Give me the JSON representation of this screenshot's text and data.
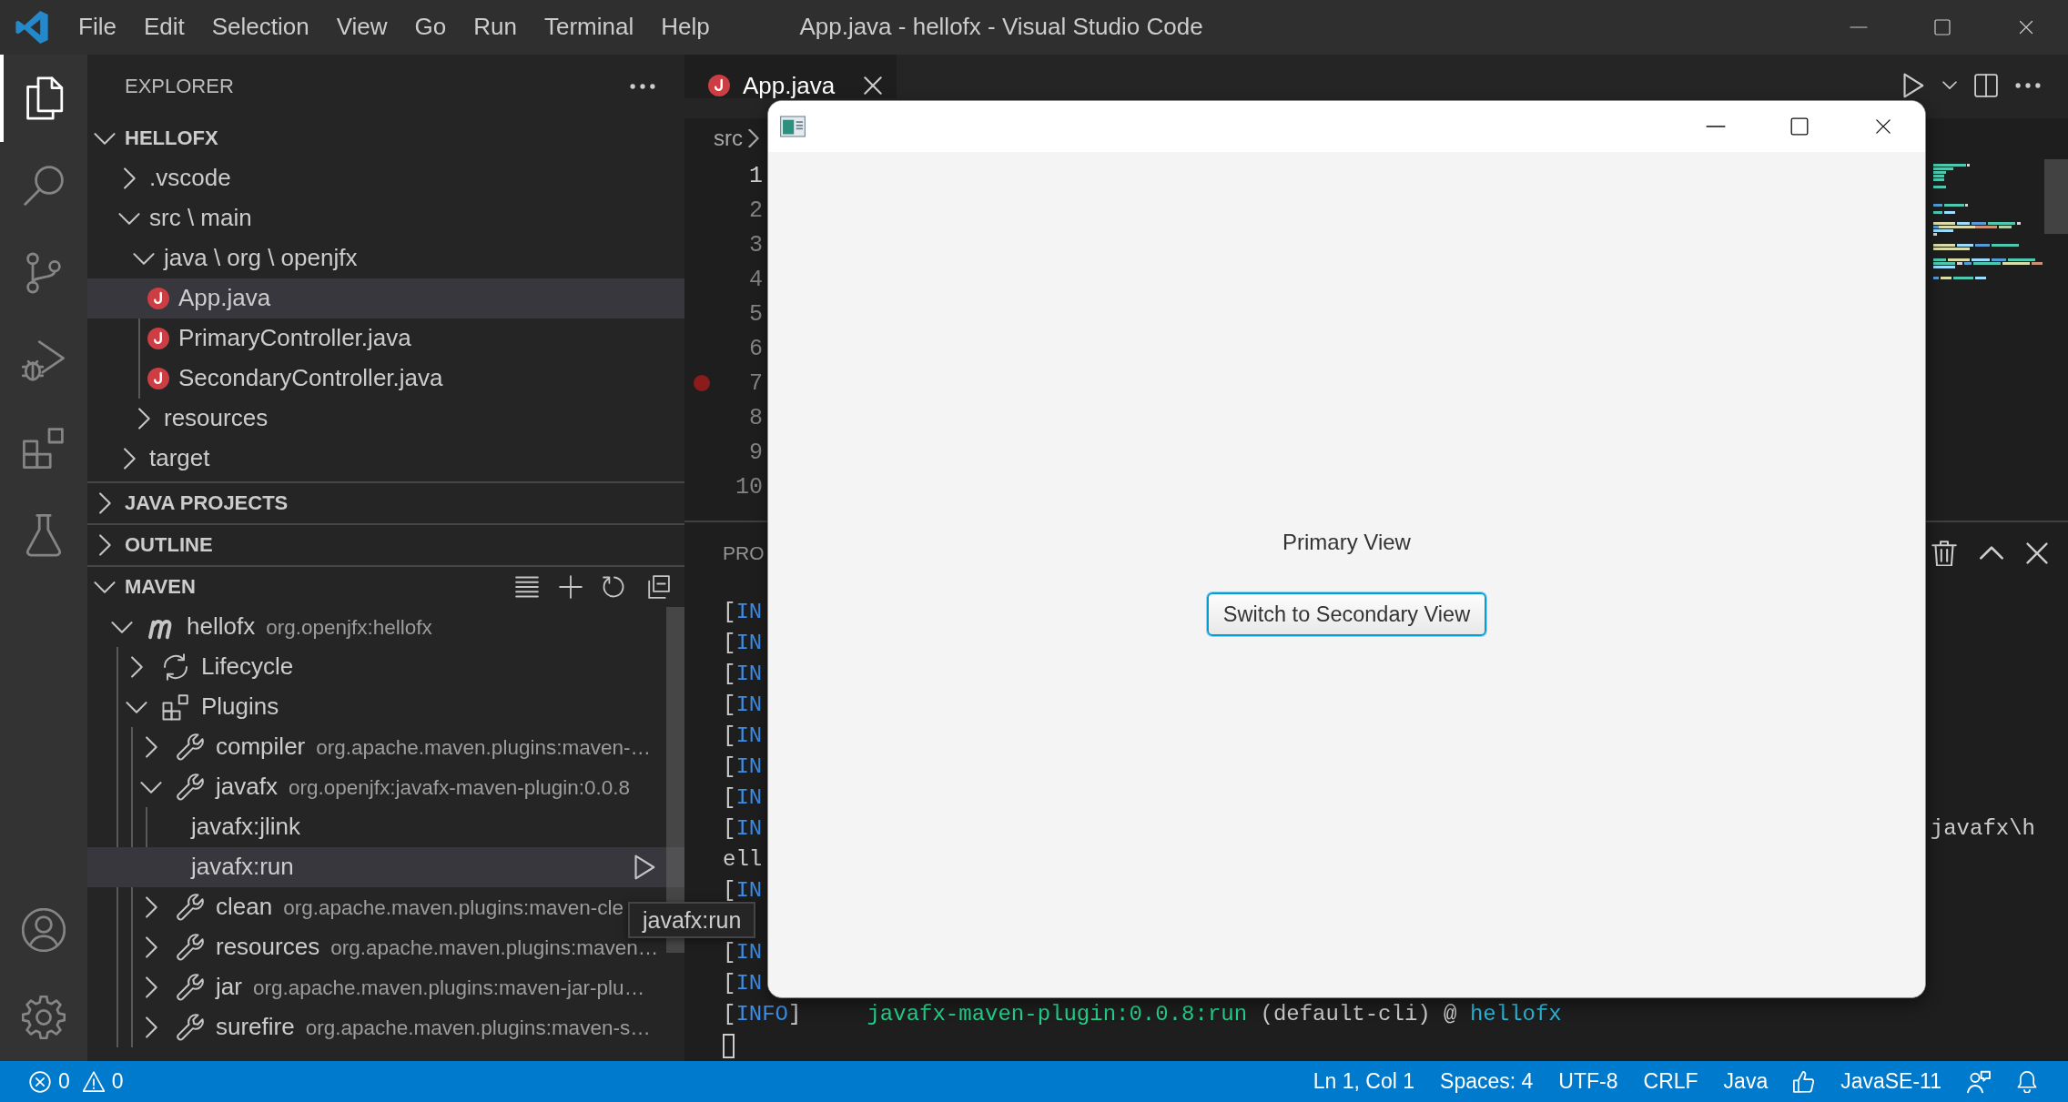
{
  "window": {
    "title": "App.java - hellofx - Visual Studio Code"
  },
  "menu": [
    "File",
    "Edit",
    "Selection",
    "View",
    "Go",
    "Run",
    "Terminal",
    "Help"
  ],
  "activity_bar": {
    "items": [
      {
        "kind": "explorer",
        "selected": true
      },
      {
        "kind": "search",
        "selected": false
      },
      {
        "kind": "source_control",
        "selected": false
      },
      {
        "kind": "run_debug",
        "selected": false
      },
      {
        "kind": "extensions",
        "selected": false
      },
      {
        "kind": "testing",
        "selected": false
      }
    ],
    "bottom": [
      {
        "kind": "accounts"
      },
      {
        "kind": "manage"
      }
    ]
  },
  "sidebar": {
    "title": "EXPLORER",
    "sections": [
      {
        "kind": "explorer",
        "title": "HELLOFX",
        "expanded": true,
        "hovered": false,
        "tree": [
          {
            "kind": "folder",
            "label": ".vscode",
            "expanded": false,
            "selected": false
          },
          {
            "kind": "folder",
            "label": "src \\ main",
            "expanded": true,
            "selected": false,
            "children": [
              {
                "kind": "folder",
                "label": "java \\ org \\ openjfx",
                "expanded": true,
                "selected": false,
                "children": [
                  {
                    "kind": "java_file",
                    "label": "App.java",
                    "selected": true
                  },
                  {
                    "kind": "java_file",
                    "label": "PrimaryController.java",
                    "selected": false
                  },
                  {
                    "kind": "java_file",
                    "label": "SecondaryController.java",
                    "selected": false
                  }
                ]
              },
              {
                "kind": "folder",
                "label": "resources",
                "expanded": false,
                "selected": false
              }
            ]
          },
          {
            "kind": "folder",
            "label": "target",
            "expanded": false,
            "selected": false
          }
        ]
      },
      {
        "kind": "view",
        "title": "JAVA PROJECTS",
        "expanded": false
      },
      {
        "kind": "view",
        "title": "OUTLINE",
        "expanded": false
      },
      {
        "kind": "maven",
        "title": "MAVEN",
        "expanded": true,
        "hovered": true,
        "tree": [
          {
            "kind": "project",
            "label": "hellofx",
            "description": "org.openjfx:hellofx",
            "expanded": true,
            "selected": false,
            "children": [
              {
                "kind": "lifecycle",
                "label": "Lifecycle",
                "expanded": false,
                "selected": false
              },
              {
                "kind": "plugins",
                "label": "Plugins",
                "expanded": true,
                "selected": false,
                "children": [
                  {
                    "kind": "plugin",
                    "label": "compiler",
                    "description": "org.apache.maven.plugins:maven-…",
                    "expanded": false,
                    "selected": false
                  },
                  {
                    "kind": "plugin",
                    "label": "javafx",
                    "description": "org.openjfx:javafx-maven-plugin:0.0.8",
                    "expanded": true,
                    "selected": false,
                    "children": [
                      {
                        "kind": "goal",
                        "label": "javafx:jlink",
                        "selected": false
                      },
                      {
                        "kind": "goal",
                        "label": "javafx:run",
                        "selected": true
                      }
                    ]
                  },
                  {
                    "kind": "plugin",
                    "label": "clean",
                    "description": "org.apache.maven.plugins:maven-cle",
                    "expanded": false,
                    "selected": false
                  },
                  {
                    "kind": "plugin",
                    "label": "resources",
                    "description": "org.apache.maven.plugins:maven…",
                    "expanded": false,
                    "selected": false
                  },
                  {
                    "kind": "plugin",
                    "label": "jar",
                    "description": "org.apache.maven.plugins:maven-jar-plu…",
                    "expanded": false,
                    "selected": false
                  },
                  {
                    "kind": "plugin",
                    "label": "surefire",
                    "description": "org.apache.maven.plugins:maven-s…",
                    "expanded": false,
                    "selected": false
                  }
                ]
              }
            ]
          }
        ]
      }
    ]
  },
  "editor": {
    "tabs": [
      {
        "kind": "java_file",
        "label": "App.java",
        "selected": true
      }
    ],
    "breadcrumb": [
      "src"
    ],
    "lines": [
      {
        "number": "1",
        "current": true,
        "breakpoint": false
      },
      {
        "number": "2",
        "current": false,
        "breakpoint": false
      },
      {
        "number": "3",
        "current": false,
        "breakpoint": false
      },
      {
        "number": "4",
        "current": false,
        "breakpoint": false
      },
      {
        "number": "5",
        "current": false,
        "breakpoint": false
      },
      {
        "number": "6",
        "current": false,
        "breakpoint": false
      },
      {
        "number": "7",
        "current": false,
        "breakpoint": true
      },
      {
        "number": "8",
        "current": false,
        "breakpoint": false
      },
      {
        "number": "9",
        "current": false,
        "breakpoint": false
      },
      {
        "number": "10",
        "current": false,
        "breakpoint": false
      }
    ]
  },
  "panel": {
    "tabs": [
      {
        "label": "PRO"
      }
    ],
    "terminal": [
      {
        "kind": "output",
        "segments": [
          {
            "kind": "bracket",
            "text": "["
          },
          {
            "kind": "level",
            "text": "IN"
          }
        ]
      },
      {
        "kind": "output",
        "segments": [
          {
            "kind": "bracket",
            "text": "["
          },
          {
            "kind": "level",
            "text": "IN"
          }
        ]
      },
      {
        "kind": "output",
        "segments": [
          {
            "kind": "bracket",
            "text": "["
          },
          {
            "kind": "level",
            "text": "IN"
          }
        ]
      },
      {
        "kind": "output",
        "segments": [
          {
            "kind": "bracket",
            "text": "["
          },
          {
            "kind": "level",
            "text": "IN"
          }
        ]
      },
      {
        "kind": "output",
        "segments": [
          {
            "kind": "bracket",
            "text": "["
          },
          {
            "kind": "level",
            "text": "IN"
          }
        ]
      },
      {
        "kind": "output",
        "segments": [
          {
            "kind": "bracket",
            "text": "["
          },
          {
            "kind": "level",
            "text": "IN"
          }
        ]
      },
      {
        "kind": "output",
        "segments": [
          {
            "kind": "bracket",
            "text": "["
          },
          {
            "kind": "level",
            "text": "IN"
          }
        ]
      },
      {
        "kind": "output",
        "segments": [
          {
            "kind": "bracket",
            "text": "["
          },
          {
            "kind": "level",
            "text": "IN"
          }
        ],
        "tail": "javafx\\h"
      },
      {
        "kind": "output",
        "segments": [
          {
            "kind": "text",
            "text": "ell"
          }
        ]
      },
      {
        "kind": "output",
        "segments": [
          {
            "kind": "bracket",
            "text": "["
          },
          {
            "kind": "level",
            "text": "IN"
          }
        ]
      },
      {
        "kind": "covered"
      },
      {
        "kind": "output",
        "segments": [
          {
            "kind": "bracket",
            "text": "["
          },
          {
            "kind": "level",
            "text": "IN"
          }
        ]
      },
      {
        "kind": "output",
        "segments": [
          {
            "kind": "bracket",
            "text": "["
          },
          {
            "kind": "level",
            "text": "IN"
          }
        ]
      },
      {
        "kind": "output",
        "segments": [
          {
            "kind": "bracket",
            "text": "["
          },
          {
            "kind": "level",
            "text": "INFO"
          },
          {
            "kind": "bracket",
            "text": "]"
          },
          {
            "kind": "plugin",
            "text": "javafx-maven-plugin:0.0.8:run"
          },
          {
            "kind": "plain",
            "text": "(default-cli) @"
          },
          {
            "kind": "project",
            "text": "hellofx"
          }
        ]
      },
      {
        "kind": "cursor"
      }
    ]
  },
  "tooltip": {
    "text": "javafx:run"
  },
  "app_window": {
    "label": "Primary View",
    "button": {
      "label": "Switch to Secondary View",
      "focused": true
    }
  },
  "status_bar": {
    "problems": [
      {
        "kind": "errors",
        "count": "0"
      },
      {
        "kind": "warnings",
        "count": "0"
      }
    ],
    "items": [
      {
        "kind": "text",
        "text": "Ln 1, Col 1"
      },
      {
        "kind": "text",
        "text": "Spaces: 4"
      },
      {
        "kind": "text",
        "text": "UTF-8"
      },
      {
        "kind": "text",
        "text": "CRLF"
      },
      {
        "kind": "text",
        "text": "Java"
      },
      {
        "kind": "language_status"
      },
      {
        "kind": "text",
        "text": "JavaSE-11"
      },
      {
        "kind": "feedback"
      },
      {
        "kind": "notifications"
      }
    ]
  }
}
